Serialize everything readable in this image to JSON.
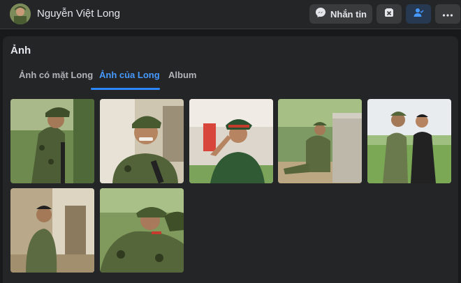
{
  "header": {
    "profile_name": "Nguyễn Việt Long",
    "message_label": "Nhắn tin",
    "icons": [
      "messenger-icon",
      "archive-icon",
      "friend-check-icon",
      "more-icon"
    ]
  },
  "photos_section": {
    "title": "Ảnh",
    "tabs": [
      {
        "label": "Ảnh có mặt Long",
        "active": false
      },
      {
        "label": "Ảnh của Long",
        "active": true
      },
      {
        "label": "Album",
        "active": false
      }
    ],
    "photo_count": 7
  },
  "colors": {
    "background": "#18191a",
    "panel": "#242526",
    "button": "#3a3b3c",
    "accent": "#2d88ff",
    "active_tab_text": "#4599ff"
  }
}
